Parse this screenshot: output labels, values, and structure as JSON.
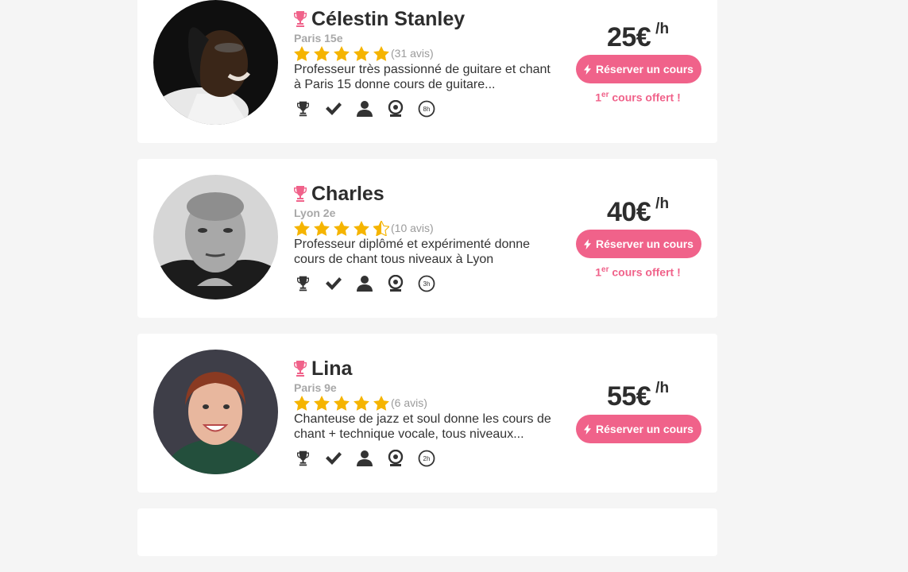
{
  "colors": {
    "accent": "#f0628a",
    "star": "#f5b400",
    "muted": "#a8a8a8"
  },
  "teachers": [
    {
      "name": "Célestin Stanley",
      "city": "Paris 15e",
      "rating": 5,
      "reviews": "(31 avis)",
      "description_line1": "Professeur très passionné de guitare et chant",
      "description_line2": "à Paris 15 donne cours de guitare...",
      "badge_hours": "8h",
      "price": "25€",
      "per": "/h",
      "book_label": "Réserver un cours",
      "offer_sup": "er",
      "offer_prefix": "1",
      "offer_text": " cours offert !"
    },
    {
      "name": "Charles",
      "city": "Lyon 2e",
      "rating": 4.5,
      "reviews": "(10 avis)",
      "description_line1": "Professeur diplômé et expérimenté donne",
      "description_line2": "cours de chant tous niveaux à Lyon",
      "badge_hours": "3h",
      "price": "40€",
      "per": "/h",
      "book_label": "Réserver un cours",
      "offer_sup": "er",
      "offer_prefix": "1",
      "offer_text": " cours offert !"
    },
    {
      "name": "Lina",
      "city": "Paris 9e",
      "rating": 5,
      "reviews": "(6 avis)",
      "description_line1": "Chanteuse de jazz et soul donne les cours de",
      "description_line2": "chant + technique vocale, tous niveaux...",
      "badge_hours": "2h",
      "price": "55€",
      "per": "/h",
      "book_label": "Réserver un cours"
    }
  ],
  "icons": {
    "title_badge": "trophy-icon",
    "badges": [
      "trophy-icon",
      "check-icon",
      "user-icon",
      "webcam-icon",
      "clock-hours-icon"
    ],
    "button": "bolt-icon",
    "rating": "star-icon"
  }
}
